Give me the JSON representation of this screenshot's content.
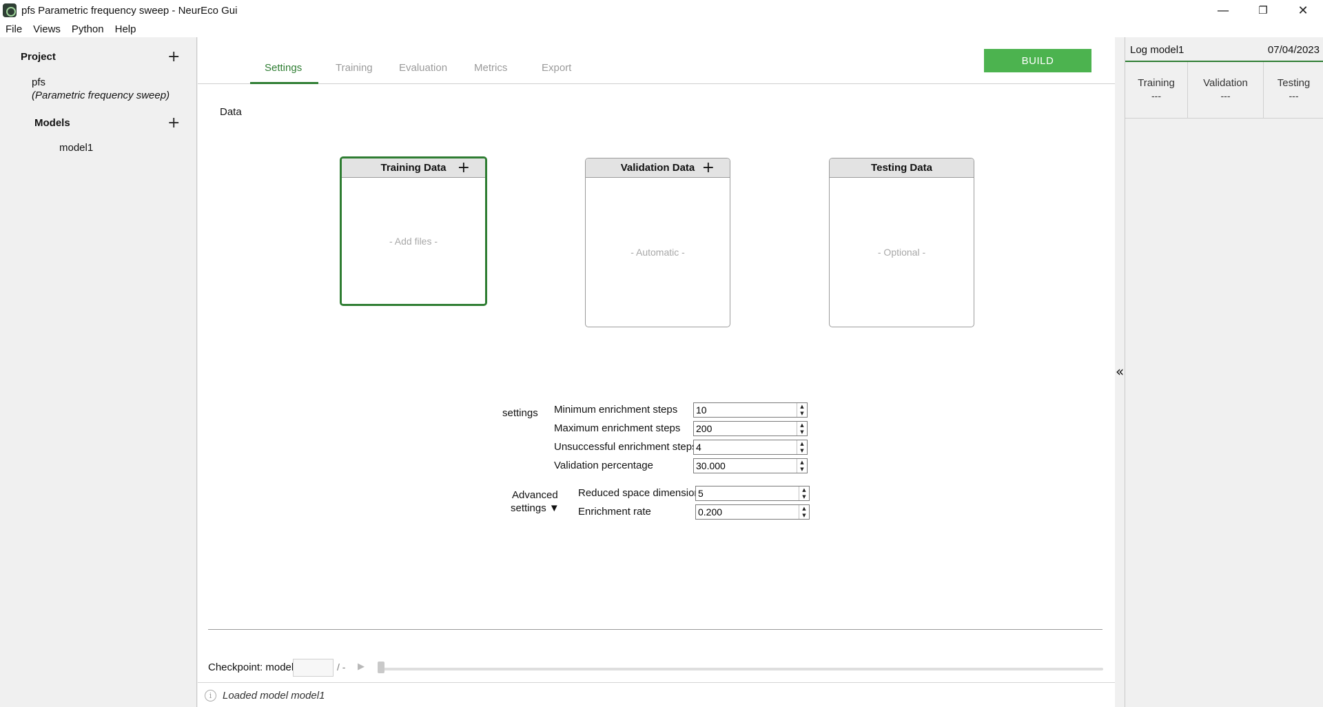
{
  "window": {
    "title": "pfs  Parametric frequency sweep  - NeurEco Gui",
    "minimize": "—",
    "restore": "❐",
    "close": "✕"
  },
  "menu": [
    "File",
    "Views",
    "Python",
    "Help"
  ],
  "left_panel": {
    "project_label": "Project",
    "project_name": "pfs",
    "project_desc": "(Parametric frequency sweep)",
    "models_label": "Models",
    "models": [
      "model1"
    ],
    "add_glyph": "+"
  },
  "tabs": [
    "Settings",
    "Training",
    "Evaluation",
    "Metrics",
    "Export"
  ],
  "active_tab": "Settings",
  "build_label": "BUILD",
  "data_section_label": "Data",
  "data_cards": {
    "training": {
      "title": "Training Data",
      "placeholder": "- Add files -",
      "add": "+"
    },
    "validation": {
      "title": "Validation Data",
      "placeholder": "- Automatic -",
      "add": "+"
    },
    "testing": {
      "title": "Testing Data",
      "placeholder": "- Optional -"
    }
  },
  "settings": {
    "label": "settings",
    "fields": [
      {
        "label": "Minimum enrichment steps",
        "value": "10"
      },
      {
        "label": "Maximum enrichment steps",
        "value": "200"
      },
      {
        "label": "Unsuccessful enrichment steps",
        "value": "4"
      },
      {
        "label": "Validation percentage",
        "value": "30.000"
      }
    ]
  },
  "advanced": {
    "label_line1": "Advanced",
    "label_line2": "settings ▼",
    "fields": [
      {
        "label": "Reduced space dimension",
        "value": "5"
      },
      {
        "label": "Enrichment rate",
        "value": "0.200"
      }
    ]
  },
  "spin_up": "▲",
  "spin_down": "▼",
  "collapse_glyph": "«",
  "checkpoint": {
    "label": "Checkpoint: model",
    "value": "",
    "total": "/ -",
    "play": "▶",
    "slider_position": 0
  },
  "status": {
    "info_glyph": "i",
    "text": "Loaded model model1"
  },
  "log": {
    "title": "Log model1",
    "date": "07/04/2023",
    "columns": [
      {
        "label": "Training",
        "value": "---"
      },
      {
        "label": "Validation",
        "value": "---"
      },
      {
        "label": "Testing",
        "value": "---"
      }
    ]
  },
  "colors": {
    "accent": "#2e7d32",
    "build": "#4cb34f"
  }
}
